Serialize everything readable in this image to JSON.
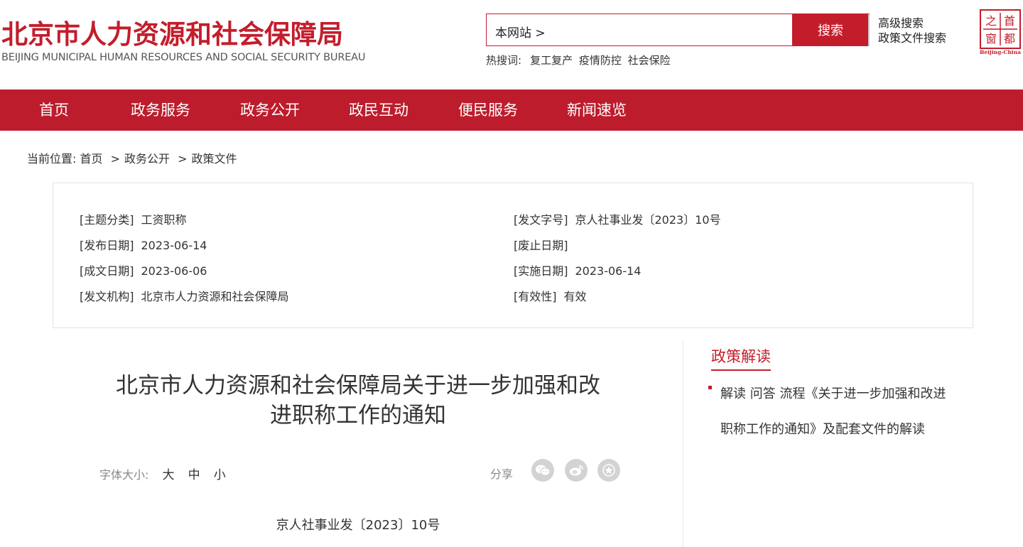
{
  "header": {
    "logo_cn": "北京市人力资源和社会保障局",
    "logo_en": "BEIJING MUNICIPAL HUMAN RESOURCES AND SOCIAL SECURITY BUREAU",
    "search_value": "本网站 >",
    "search_button": "搜索",
    "advanced_search": "高级搜索",
    "policy_search": "政策文件搜索",
    "hot_label": "热搜词:",
    "hot_words": [
      "复工复产",
      "疫情防控",
      "社会保险"
    ],
    "capital_logo_chars": [
      "首",
      "都",
      "之",
      "窗"
    ],
    "capital_logo_en": "Beijing-China"
  },
  "nav": {
    "items": [
      "首页",
      "政务服务",
      "政务公开",
      "政民互动",
      "便民服务",
      "新闻速览"
    ]
  },
  "breadcrumb": {
    "label": "当前位置:",
    "items": [
      "首页",
      "政务公开",
      "政策文件"
    ],
    "sep": ">"
  },
  "meta": {
    "topic_label": "[主题分类]",
    "topic_value": "工资职称",
    "docno_label": "[发文字号]",
    "docno_value": "京人社事业发〔2023〕10号",
    "publish_label": "[发布日期]",
    "publish_value": "2023-06-14",
    "abolish_label": "[废止日期]",
    "abolish_value": "",
    "written_label": "[成文日期]",
    "written_value": "2023-06-06",
    "effective_label": "[实施日期]",
    "effective_value": "2023-06-14",
    "org_label": "[发文机构]",
    "org_value": "北京市人力资源和社会保障局",
    "validity_label": "[有效性]",
    "validity_value": "有效"
  },
  "article": {
    "title_line1": "北京市人力资源和社会保障局关于进一步加强和改",
    "title_line2": "进职称工作的通知",
    "fontsize_label": "字体大小:",
    "fontsize_options": [
      "大",
      "中",
      "小"
    ],
    "share_label": "分享",
    "doc_number": "京人社事业发〔2023〕10号"
  },
  "sidebar": {
    "title": "政策解读",
    "link": "解读 问答 流程《关于进一步加强和改进职称工作的通知》及配套文件的解读"
  },
  "colors": {
    "brand_red": "#c31d2c",
    "nav_red": "#bd1c2c"
  }
}
